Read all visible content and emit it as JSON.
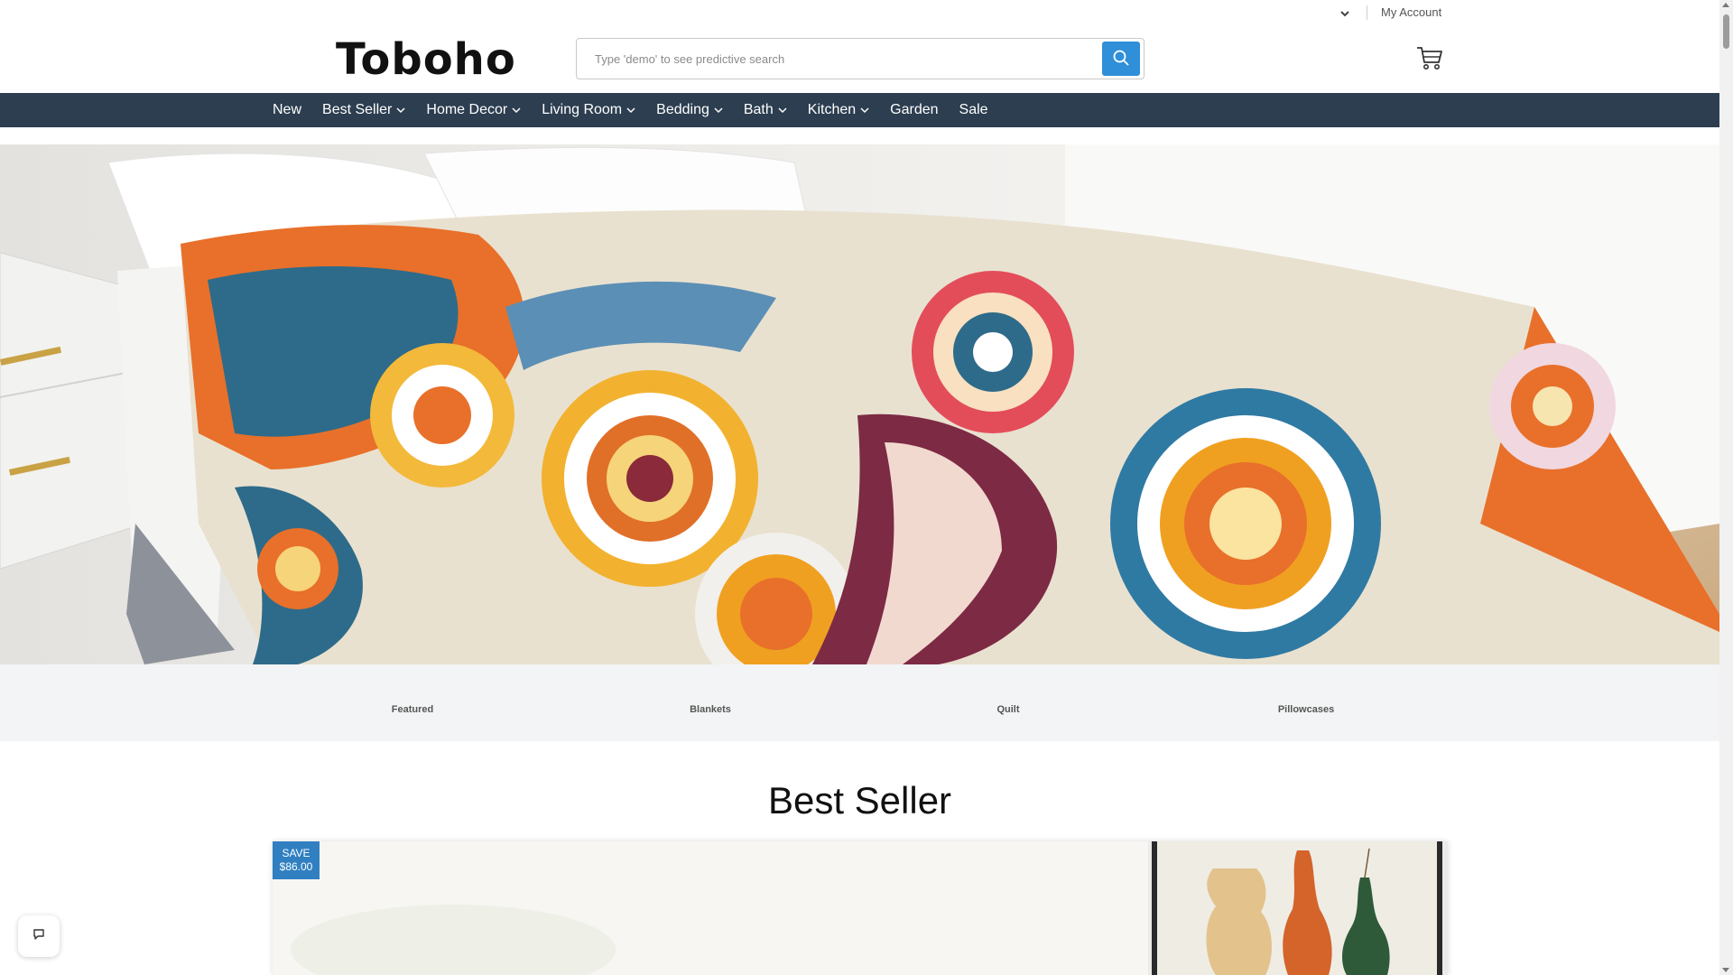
{
  "util_bar": {
    "my_account": "My Account",
    "dropdown_icon": "chevron-down-icon"
  },
  "header": {
    "logo": "Toboho",
    "search": {
      "placeholder": "Type 'demo' to see predictive search",
      "value": "",
      "button_icon": "search-icon"
    },
    "cart_icon": "cart-icon"
  },
  "nav": {
    "items": [
      {
        "label": "New",
        "has_dropdown": false
      },
      {
        "label": "Best Seller",
        "has_dropdown": true
      },
      {
        "label": "Home Decor",
        "has_dropdown": true
      },
      {
        "label": "Living Room",
        "has_dropdown": true
      },
      {
        "label": "Bedding",
        "has_dropdown": true
      },
      {
        "label": "Bath",
        "has_dropdown": true
      },
      {
        "label": "Kitchen",
        "has_dropdown": true
      },
      {
        "label": "Garden",
        "has_dropdown": false
      },
      {
        "label": "Sale",
        "has_dropdown": false
      }
    ]
  },
  "categories": [
    "Featured",
    "Blankets",
    "Quilt",
    "Pillowcases"
  ],
  "best_seller": {
    "title": "Best Seller",
    "badge": {
      "line1": "SAVE",
      "line2": "$86.00"
    }
  },
  "chat_icon": "chat-icon",
  "colors": {
    "nav_bg": "#2c3e50",
    "search_button": "#2f8fd8",
    "badge": "#2f7fc1",
    "category_strip": "#f3f4f5"
  }
}
